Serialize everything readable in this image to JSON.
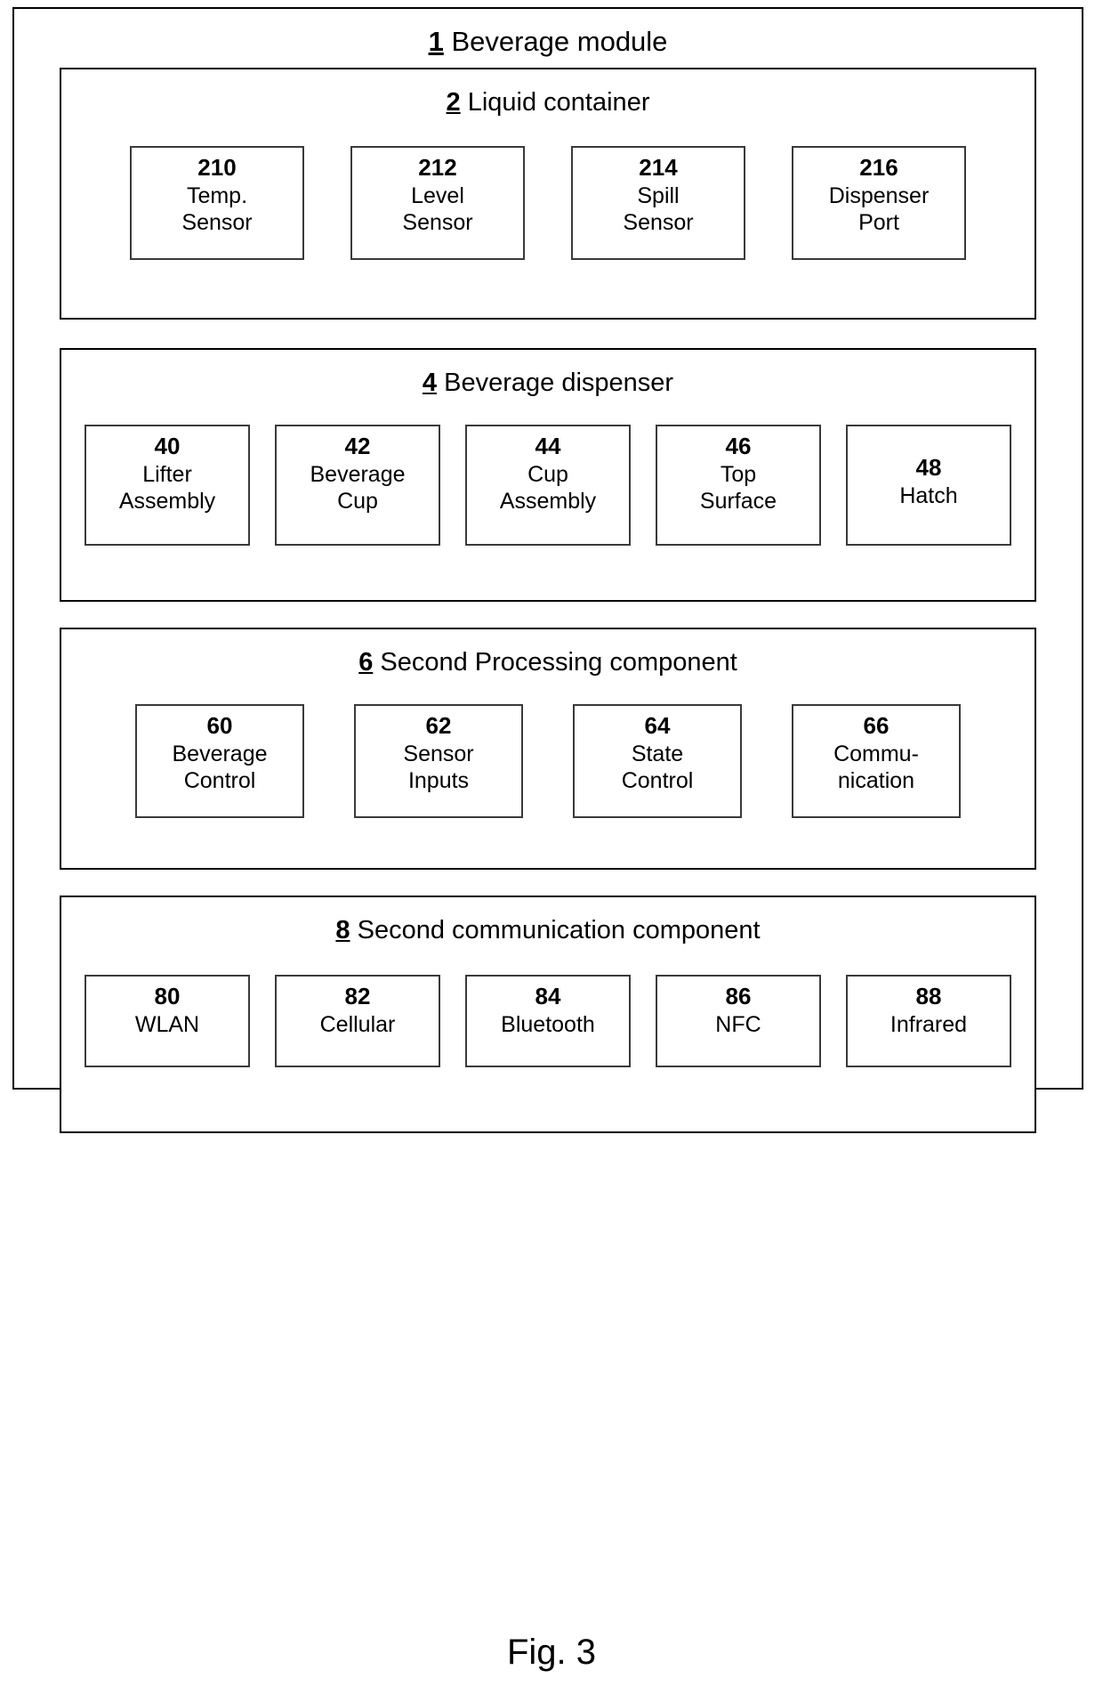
{
  "figure": {
    "caption": "Fig. 3",
    "root": {
      "ref": "1",
      "title": "Beverage module"
    },
    "sections": [
      {
        "ref": "2",
        "title": "Liquid container",
        "boxes": [
          {
            "ref": "210",
            "label": "Temp.\nSensor"
          },
          {
            "ref": "212",
            "label": "Level\nSensor"
          },
          {
            "ref": "214",
            "label": "Spill\nSensor"
          },
          {
            "ref": "216",
            "label": "Dispenser\nPort"
          }
        ]
      },
      {
        "ref": "4",
        "title": "Beverage dispenser",
        "boxes": [
          {
            "ref": "40",
            "label": "Lifter\nAssembly"
          },
          {
            "ref": "42",
            "label": "Beverage\nCup"
          },
          {
            "ref": "44",
            "label": "Cup\nAssembly"
          },
          {
            "ref": "46",
            "label": "Top\nSurface"
          },
          {
            "ref": "48",
            "label": "Hatch"
          }
        ]
      },
      {
        "ref": "6",
        "title": "Second Processing component",
        "boxes": [
          {
            "ref": "60",
            "label": "Beverage\nControl"
          },
          {
            "ref": "62",
            "label": "Sensor\nInputs"
          },
          {
            "ref": "64",
            "label": "State\nControl"
          },
          {
            "ref": "66",
            "label": "Commu-\nnication"
          }
        ]
      },
      {
        "ref": "8",
        "title": "Second communication component",
        "boxes": [
          {
            "ref": "80",
            "label": "WLAN"
          },
          {
            "ref": "82",
            "label": "Cellular"
          },
          {
            "ref": "84",
            "label": "Bluetooth"
          },
          {
            "ref": "86",
            "label": "NFC"
          },
          {
            "ref": "88",
            "label": "Infrared"
          }
        ]
      }
    ]
  },
  "colors": {
    "ink": "#000000",
    "box_border": "#3a3a3a",
    "background": "#ffffff"
  }
}
